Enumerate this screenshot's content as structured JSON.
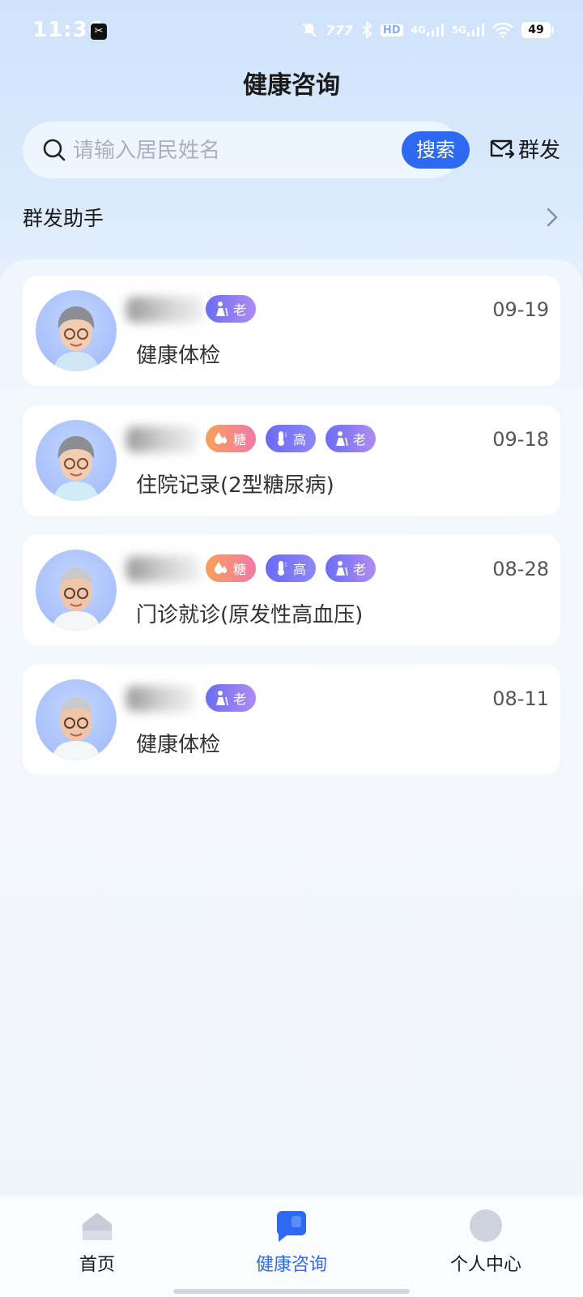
{
  "status_bar": {
    "time": "11:36",
    "app_icon": "capcut-icon",
    "network_a": "4G",
    "network_b": "5G",
    "hd_label": "HD",
    "battery": "49"
  },
  "header": {
    "title": "健康咨询"
  },
  "search": {
    "placeholder": "请输入居民姓名",
    "value": "",
    "button_label": "搜索"
  },
  "mass_send": {
    "label": "群发",
    "icon": "mail-send-icon"
  },
  "assistant": {
    "label": "群发助手"
  },
  "residents": [
    {
      "date": "09-19",
      "record": "健康体检",
      "tags": [
        "老"
      ]
    },
    {
      "date": "09-18",
      "record": "住院记录(2型糖尿病)",
      "tags": [
        "糖",
        "高",
        "老"
      ]
    },
    {
      "date": "08-28",
      "record": "门诊就诊(原发性高血压)",
      "tags": [
        "糖",
        "高",
        "老"
      ]
    },
    {
      "date": "08-11",
      "record": "健康体检",
      "tags": [
        "老"
      ]
    }
  ],
  "tag_labels": {
    "sugar": "糖",
    "high": "高",
    "old": "老"
  },
  "colors": {
    "accent": "#2e6af1",
    "tag_sugar": "#f7a05a",
    "tag_high": "#6b6bf3",
    "tag_old": "#8f7df3"
  },
  "nav": [
    {
      "label": "首页",
      "icon": "home-icon",
      "active": false
    },
    {
      "label": "健康咨询",
      "icon": "chat-icon",
      "active": true
    },
    {
      "label": "个人中心",
      "icon": "profile-icon",
      "active": false
    }
  ]
}
